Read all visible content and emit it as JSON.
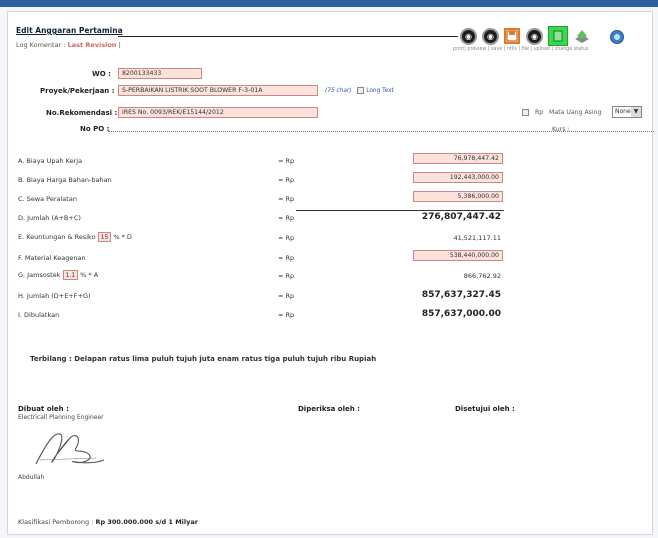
{
  "header": {
    "title": "Edit Anggaran Pertamina",
    "log_prefix": "Log Komentar : ",
    "log_link": "Last Revision",
    "log_suffix": " |"
  },
  "toolbar": {
    "labels": "print| preview | save | ntils | file | upload | change status",
    "buttons": [
      {
        "name": "print-button",
        "icon": "print-icon"
      },
      {
        "name": "preview-button",
        "icon": "preview-icon"
      },
      {
        "name": "save-button",
        "icon": "floppy-disk-icon"
      },
      {
        "name": "edit-button",
        "icon": "edit-icon"
      },
      {
        "name": "file-button",
        "icon": "file-icon"
      },
      {
        "name": "upload-button",
        "icon": "upload-icon"
      },
      {
        "name": "change-status-button",
        "icon": "status-icon"
      }
    ]
  },
  "form": {
    "wo_label": "WO :",
    "wo_value": "8200133433",
    "proyek_label": "Proyek/Pekerjaan :",
    "proyek_value": "S-PERBAIKAN LISTRIK SOOT BLOWER F-3-01A",
    "char_hint": "(75 char)",
    "long_text": "Long Text",
    "rekomendasi_label": "No.Rekomendasi :",
    "rekomendasi_value": "IRES No. 0093/REK/E15144/2012",
    "po_label": "No PO :",
    "rp_label": "Rp",
    "mata_uang_label": "Mata Uang Asing",
    "mata_uang_value": "None",
    "kurs_label": "Kurs :"
  },
  "rows": [
    {
      "label": "A. Biaya Upah Kerja",
      "eq": "= Rp",
      "value": "76,978,447.42"
    },
    {
      "label": "B. Biaya Harga Bahan-bahan",
      "eq": "= Rp",
      "value": "192,443,000.00"
    },
    {
      "label": "C. Sewa Peralatan",
      "eq": "= Rp",
      "value": "5,386,000.00"
    },
    {
      "label": "D. Jumlah (A+B+C)",
      "eq": "= Rp",
      "value": "276,807,447.42"
    },
    {
      "label_pre": "E. Keuntungan & Resiko",
      "pct": "15",
      "label_post": "% * D",
      "eq": "= Rp",
      "value": "41,521,117.11"
    },
    {
      "label": "F. Material Keagenan",
      "eq": "= Rp",
      "value": "538,440,000.00"
    },
    {
      "label_pre": "G. Jamsostek",
      "pct": "1.1",
      "label_post": "% * A",
      "eq": "= Rp",
      "value": "866,762.92"
    },
    {
      "label": "H. Jumlah (D+E+F+G)",
      "eq": "= Rp",
      "value": "857,637,327.45"
    },
    {
      "label": "I. Dibulatkan",
      "eq": "= Rp",
      "value": "857,637,000.00"
    }
  ],
  "terbilang": "Terbilang : Delapan ratus lima puluh tujuh juta enam ratus tiga puluh tujuh ribu Rupiah",
  "footer": {
    "dibuat_label": "Dibuat oleh :",
    "dibuat_role": "Electricall Planning Engineer",
    "signer_name": "Abdullah",
    "diperiksa_label": "Diperiksa oleh :",
    "disetujui_label": "Disetujui oleh :",
    "klasifikasi_label": "Klasifikasi Pemborong : ",
    "klasifikasi_value": "Rp 300.000.000 s/d 1 Milyar"
  },
  "colors": {
    "accent": "#2f5e9e",
    "field_bg": "#fbe3dc",
    "field_border": "#cc8888",
    "link": "#cc6666",
    "upload_green": "#39d84a"
  }
}
